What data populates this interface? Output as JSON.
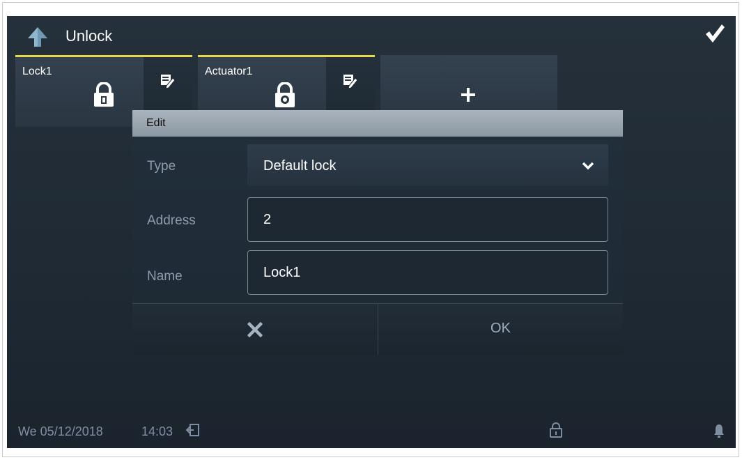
{
  "header": {
    "title": "Unlock"
  },
  "tiles": [
    {
      "label": "Lock1"
    },
    {
      "label": "Actuator1"
    }
  ],
  "dialog": {
    "title": "Edit",
    "type_label": "Type",
    "type_value": "Default lock",
    "address_label": "Address",
    "address_value": "2",
    "name_label": "Name",
    "name_value": "Lock1",
    "ok_label": "OK"
  },
  "status": {
    "date": "We 05/12/2018",
    "time": "14:03"
  },
  "icons": {
    "back": "arrow-up-icon",
    "confirm": "checkmark-icon",
    "edit": "pencil-note-icon",
    "lock": "padlock-icon",
    "add": "plus-icon",
    "dropdown": "chevron-down-icon",
    "cancel": "x-icon",
    "logout": "exit-door-icon",
    "bell": "bell-icon"
  },
  "colors": {
    "selected_tab": "#e5d84a",
    "back_arrow": "#8fb6cf",
    "background": "#222d37"
  }
}
